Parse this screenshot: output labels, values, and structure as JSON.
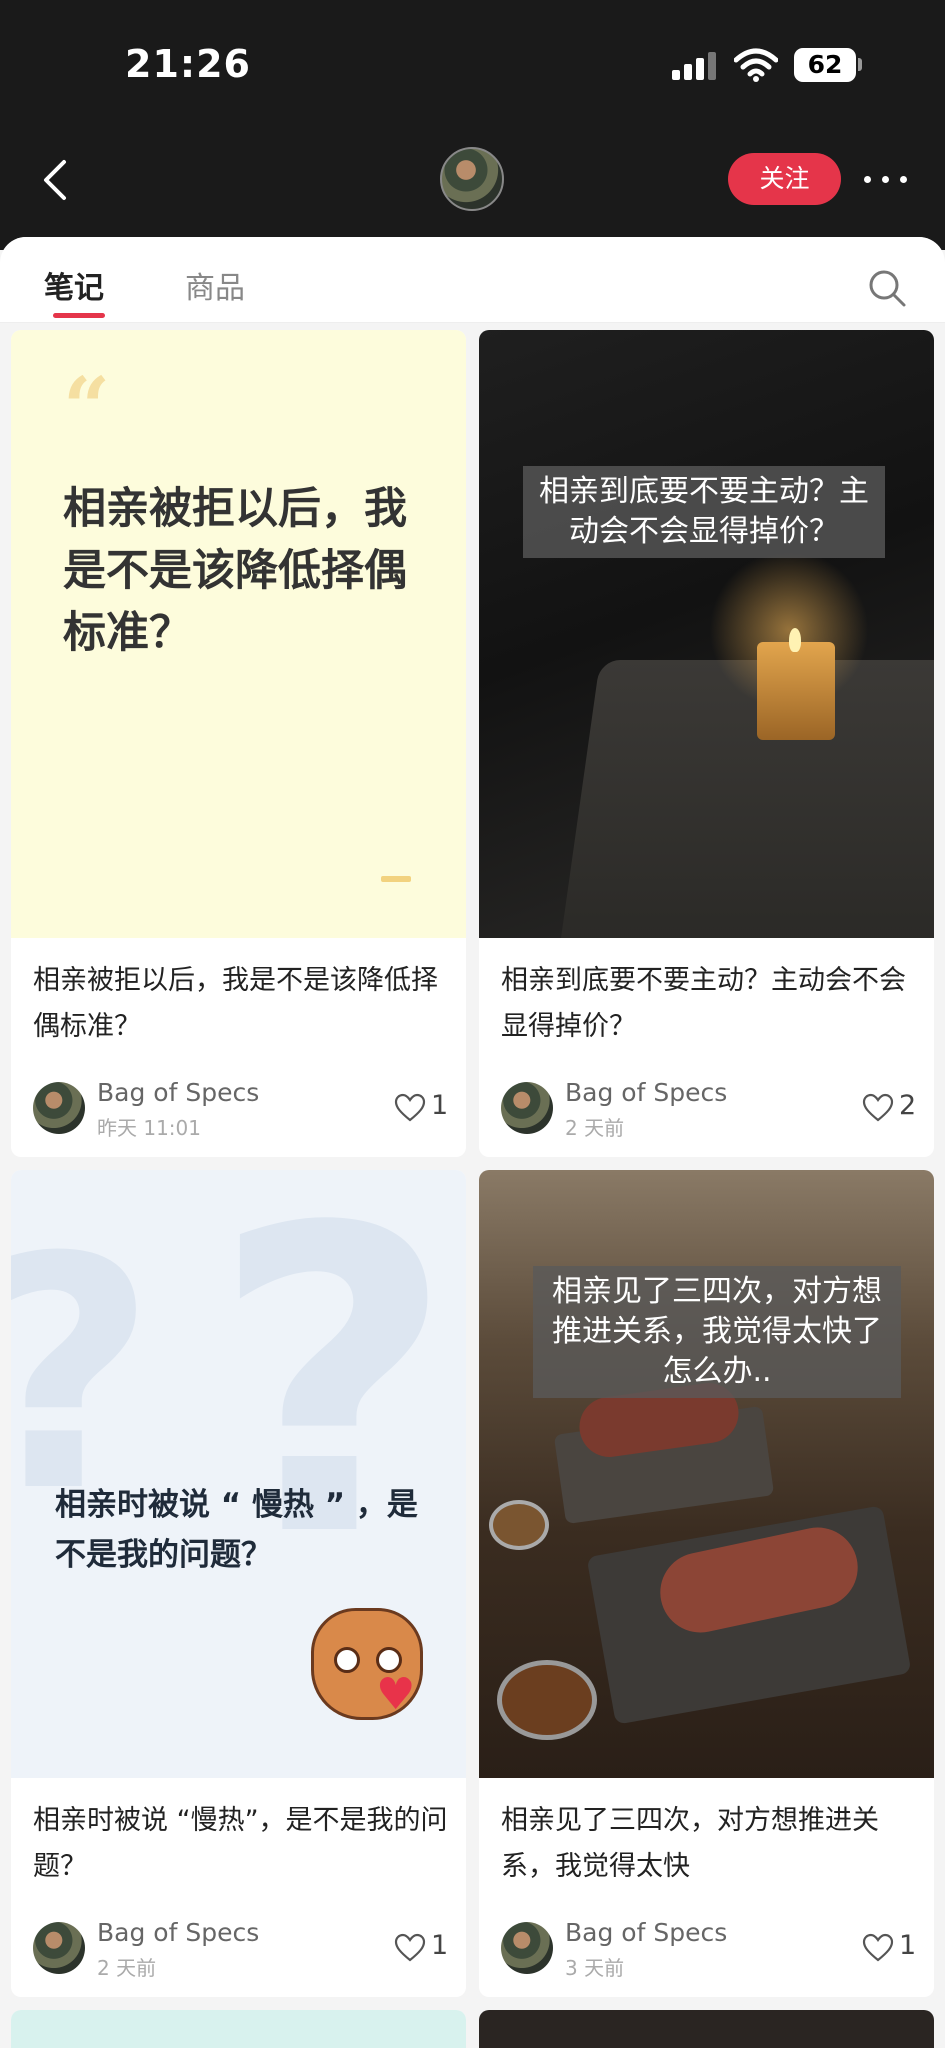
{
  "status_bar": {
    "time": "21:26",
    "battery": "62"
  },
  "nav": {
    "follow_label": "关注"
  },
  "tabs": {
    "notes": "笔记",
    "goods": "商品"
  },
  "cards": [
    {
      "cover_quote": "“",
      "cover_text": "相亲被拒以后，我是不是该降低择偶标准？",
      "title": "相亲被拒以后，我是不是该降低择偶标准？",
      "author": "Bag of Specs",
      "time": "昨天 11:01",
      "likes": "1"
    },
    {
      "cover_caption": "相亲到底要不要主动？主动会不会显得掉价？",
      "title": "相亲到底要不要主动？主动会不会显得掉价？",
      "author": "Bag of Specs",
      "time": "2 天前",
      "likes": "2"
    },
    {
      "cover_text": "相亲时被说 “ 慢热 ” ，是不是我的问题？",
      "title": "相亲时被说 “慢热”，是不是我的问题？",
      "author": "Bag of Specs",
      "time": "2 天前",
      "likes": "1"
    },
    {
      "cover_caption": "相亲见了三四次，对方想推进关系，我觉得太快了 怎么办..",
      "title": "相亲见了三四次，对方想推进关系，我觉得太快",
      "author": "Bag of Specs",
      "time": "3 天前",
      "likes": "1"
    }
  ],
  "colors": {
    "accent": "#e5354a",
    "dark_header": "#1a1a1a"
  },
  "icons": [
    "back-icon",
    "more-icon",
    "search-icon",
    "heart-icon",
    "signal-icon",
    "wifi-icon",
    "battery-icon"
  ]
}
